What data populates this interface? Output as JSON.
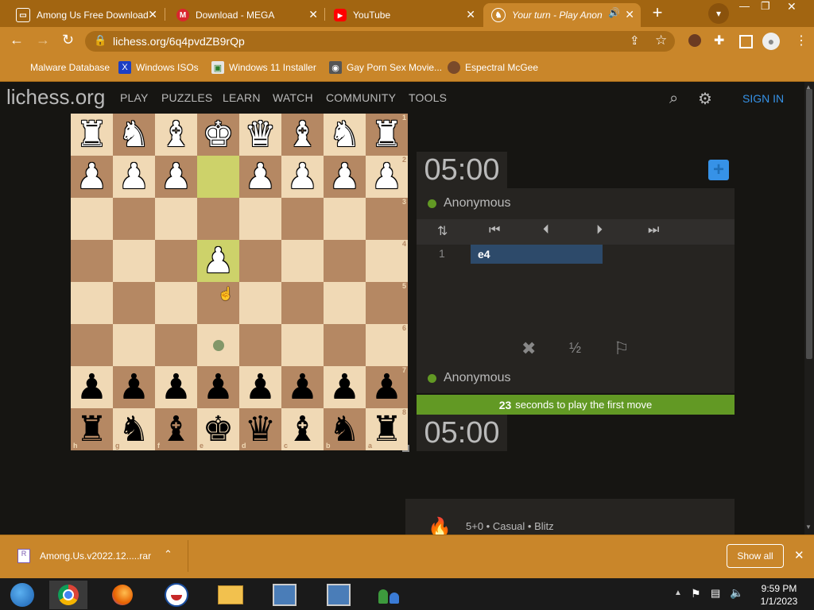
{
  "browser": {
    "tabs": [
      {
        "title": "Among Us Free Download",
        "favicon": "document-icon",
        "active": false
      },
      {
        "title": "Download - MEGA",
        "favicon": "mega-icon",
        "active": false
      },
      {
        "title": "YouTube",
        "favicon": "youtube-icon",
        "active": false
      },
      {
        "title": "Your turn - Play Anon",
        "favicon": "lichess-icon",
        "active": true
      }
    ],
    "url": "lichess.org/6q4pvdZB9rQp",
    "bookmarks": [
      {
        "label": "Malware Database"
      },
      {
        "label": "Windows ISOs",
        "icon": "X"
      },
      {
        "label": "Windows 11 Installer"
      },
      {
        "label": "Gay Porn Sex Movie..."
      },
      {
        "label": "Espectral McGee"
      }
    ],
    "accent_color": "#c9862a"
  },
  "site": {
    "logo_main": "lichess",
    "logo_tld": ".org",
    "nav": [
      "PLAY",
      "PUZZLES",
      "LEARN",
      "WATCH",
      "COMMUNITY",
      "TOOLS"
    ],
    "sign_in": "SIGN IN"
  },
  "board": {
    "rows": [
      [
        "R",
        "N",
        "B",
        "K",
        "Q",
        "B",
        "N",
        "R"
      ],
      [
        "P",
        "P",
        "P",
        "",
        "P",
        "P",
        "P",
        "P"
      ],
      [
        "",
        "",
        "",
        "",
        "",
        "",
        "",
        ""
      ],
      [
        "",
        "",
        "",
        "P",
        "",
        "",
        "",
        ""
      ],
      [
        "",
        "",
        "",
        "",
        "",
        "",
        "",
        ""
      ],
      [
        "",
        "",
        "",
        "",
        "",
        "",
        "",
        ""
      ],
      [
        "p",
        "p",
        "p",
        "p",
        "p",
        "p",
        "p",
        "p"
      ],
      [
        "r",
        "n",
        "b",
        "k",
        "q",
        "b",
        "n",
        "r"
      ]
    ],
    "last_move": [
      "e2",
      "e4"
    ],
    "rank_labels": [
      "1",
      "2",
      "3",
      "4",
      "5",
      "6",
      "7",
      "8"
    ],
    "file_labels": [
      "h",
      "g",
      "f",
      "e",
      "d",
      "c",
      "b",
      "a"
    ],
    "colors": {
      "light": "#f0d9b5",
      "dark": "#b58863",
      "highlight": "#cdd26a"
    }
  },
  "game": {
    "top_clock": "05:00",
    "bottom_clock": "05:00",
    "top_player": "Anonymous",
    "bottom_player": "Anonymous",
    "moves": [
      {
        "number": "1",
        "white": "e4"
      }
    ],
    "first_move_seconds": "23",
    "first_move_text": "seconds to play the first move",
    "draw_label": "½",
    "info": "5+0 • Casual • Blitz"
  },
  "downloads": {
    "file": "Among.Us.v2022.12.....rar",
    "show_all": "Show all"
  },
  "taskbar": {
    "time": "9:59 PM",
    "date": "1/1/2023"
  }
}
